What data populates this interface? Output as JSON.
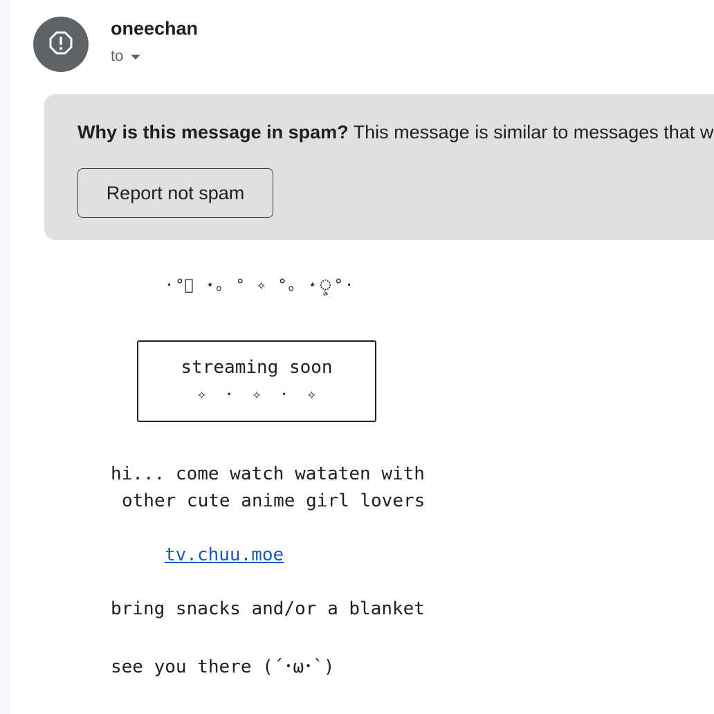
{
  "sender": {
    "name": "oneechan",
    "avatar_icon": "alert-circle-icon",
    "avatar_color": "#5f6368"
  },
  "recipient": {
    "label": "to",
    "dropdown_icon": "caret-down-icon"
  },
  "spam_banner": {
    "question": "Why is this message in spam?",
    "explanation": " This message is similar to messages that w",
    "button_label": "Report not spam",
    "background": "#e0e0e0"
  },
  "message": {
    "sparkle_line": "·°ৢ ⋆｡ ° ✧ °｡ ⋆ৢ°·",
    "box_title": "streaming soon",
    "box_sparkles": "✧  ·  ✧  ·  ✧",
    "line1": "hi... come watch wataten with",
    "line2": "other cute anime girl lovers",
    "link_text": "tv.chuu.moe",
    "line3": "bring snacks and/or a blanket",
    "line4": "see you there (´･ω･`)",
    "link_color": "#1a56c8"
  }
}
